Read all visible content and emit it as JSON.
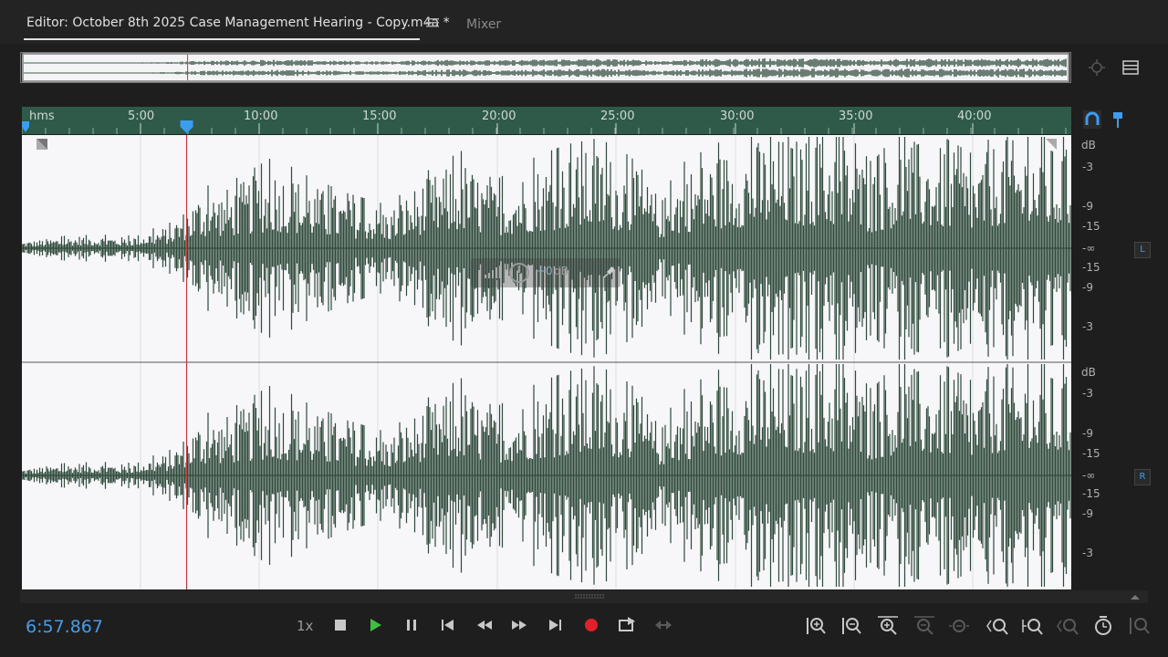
{
  "tabs": {
    "editor_label": "Editor: October 8th 2025 Case Management Hearing - Copy.m4a *",
    "mixer_label": "Mixer"
  },
  "ruler": {
    "unit_label": "hms",
    "ticks": [
      "5:00",
      "10:00",
      "15:00",
      "20:00",
      "25:00",
      "30:00",
      "35:00",
      "40:00"
    ]
  },
  "db_scale": {
    "left": [
      "dB",
      "-3",
      "-9",
      "-15",
      "-∞",
      "-15",
      "-9",
      "-3"
    ],
    "right": [
      "dB",
      "-3",
      "-9",
      "-15",
      "-∞",
      "-15",
      "-9",
      "-3"
    ],
    "left_channel": "L",
    "right_channel": "R"
  },
  "hud": {
    "volume_value": "+0",
    "unit": "dB"
  },
  "transport": {
    "current_time": "6:57.867",
    "playback_speed": "1x"
  },
  "playhead_position_fraction": 0.157,
  "icons": {
    "stop": "stop-icon",
    "play": "play-icon",
    "pause": "pause-icon",
    "to_start": "skip-start-icon",
    "rewind": "rewind-icon",
    "forward": "fast-forward-icon",
    "to_end": "skip-end-icon",
    "record": "record-icon",
    "skip_selection": "skip-selection-icon",
    "loop": "loop-icon"
  },
  "colors": {
    "waveform": "#2f4a3b",
    "ruler_bg": "#2f5a49",
    "time_display": "#4a9ce8",
    "playhead": "#c23a3a",
    "record": "#e0202a",
    "play": "#3fbf3f"
  }
}
